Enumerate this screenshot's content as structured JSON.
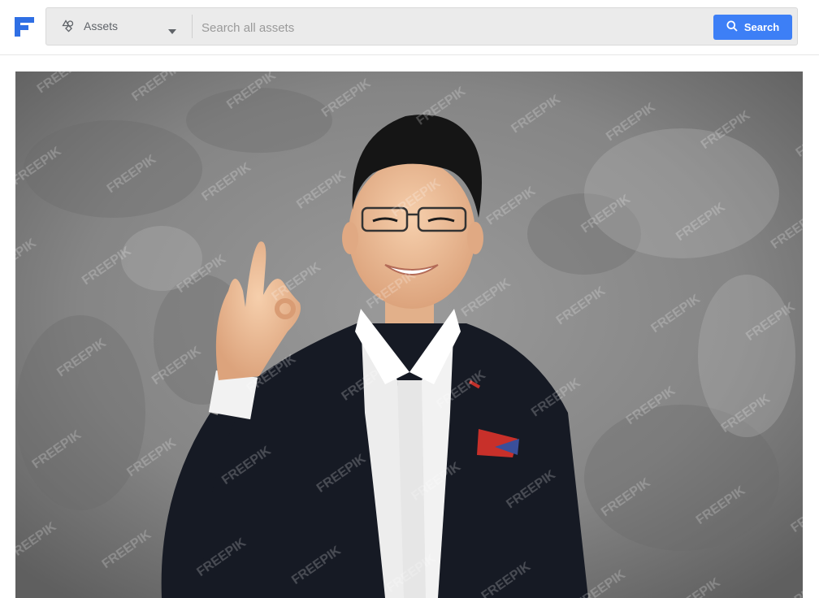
{
  "header": {
    "logo_icon": "freepik-logo-icon",
    "brand_color": "#2f6fe4",
    "asset_type": {
      "icon": "shapes-icon",
      "label": "Assets"
    },
    "search": {
      "placeholder": "Search all assets",
      "value": ""
    },
    "search_button": {
      "icon": "search-icon",
      "label": "Search",
      "color": "#3d7ff6"
    }
  },
  "main": {
    "photo": {
      "watermark": "FREEPIK"
    }
  }
}
